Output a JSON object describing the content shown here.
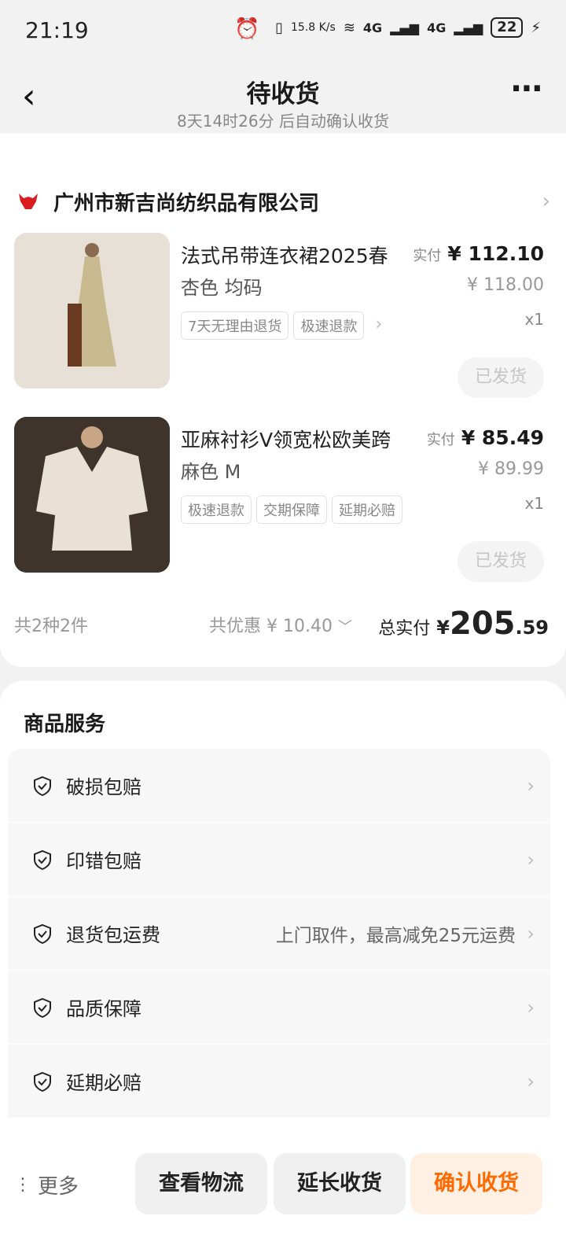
{
  "status": {
    "time": "21:19",
    "net_speed": "15.8 K/s",
    "sig1": "4G",
    "sig2": "4G",
    "battery": "22"
  },
  "header": {
    "title": "待收货",
    "subtitle": "8天14时26分 后自动确认收货"
  },
  "shop": {
    "name": "广州市新吉尚纺织品有限公司"
  },
  "products": [
    {
      "title": "法式吊带连衣裙2025春",
      "spec": "杏色 均码",
      "tags": [
        "7天无理由退货",
        "极速退款"
      ],
      "price_label": "实付",
      "price": "¥ 112.10",
      "orig_price": "¥ 118.00",
      "qty": "x1",
      "status": "已发货"
    },
    {
      "title": "亚麻衬衫V领宽松欧美跨",
      "spec": "麻色 M",
      "tags": [
        "极速退款",
        "交期保障",
        "延期必赔"
      ],
      "price_label": "实付",
      "price": "¥ 85.49",
      "orig_price": "¥ 89.99",
      "qty": "x1",
      "status": "已发货"
    }
  ],
  "summary": {
    "count": "共2种2件",
    "discount": "共优惠 ¥ 10.40",
    "total_label": "总实付",
    "total_yen": "¥",
    "total_int": "205",
    "total_dec": ".59"
  },
  "services": {
    "title": "商品服务",
    "items": [
      {
        "label": "破损包赔",
        "desc": ""
      },
      {
        "label": "印错包赔",
        "desc": ""
      },
      {
        "label": "退货包运费",
        "desc": "上门取件，最高减免25元运费"
      },
      {
        "label": "品质保障",
        "desc": ""
      },
      {
        "label": "延期必赔",
        "desc": ""
      }
    ]
  },
  "bottom": {
    "more": "更多",
    "logistics": "查看物流",
    "extend": "延长收货",
    "confirm": "确认收货"
  },
  "colors": {
    "accent": "#ff6a00",
    "shop_logo": "#d81e1e"
  }
}
